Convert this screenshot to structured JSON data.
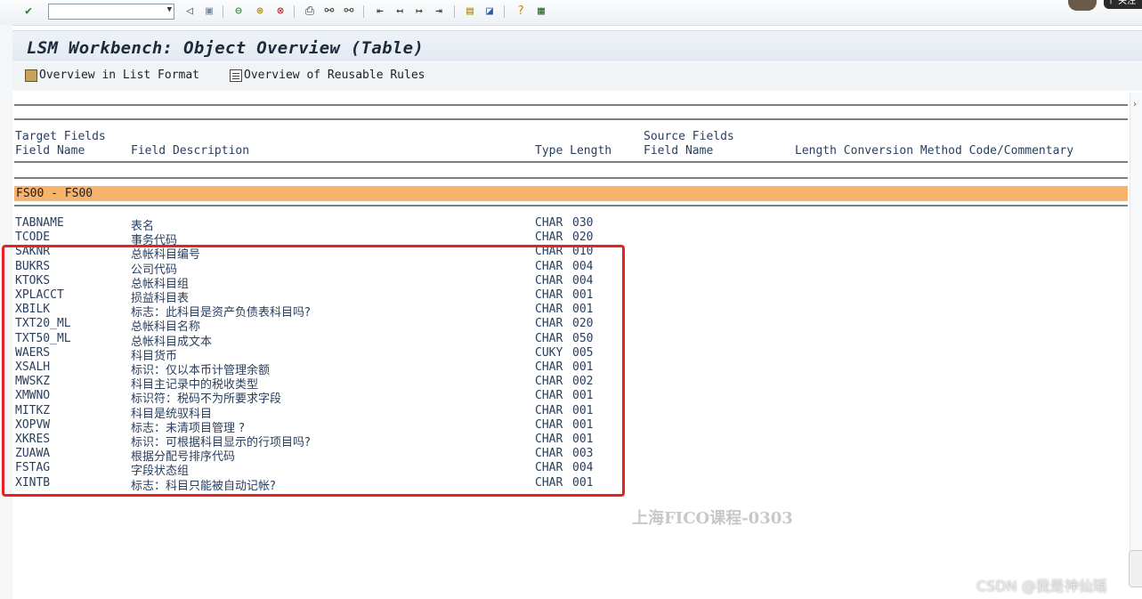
{
  "colors": {
    "group_bar": "#f7b26b",
    "highlight_box": "#e8231f",
    "text": "#2a3e5e"
  },
  "toolbar": {
    "icons": [
      "enter-icon",
      "command-dropdown-icon",
      "back-arrow-icon",
      "save-icon",
      "back-icon",
      "exit-icon",
      "cancel-icon",
      "print-icon",
      "find-icon",
      "find-next-icon",
      "first-page-icon",
      "previous-page-icon",
      "next-page-icon",
      "last-page-icon",
      "new-session-icon",
      "shortcut-icon",
      "help-icon",
      "layout-icon"
    ],
    "command_value": "",
    "avatar_text": "个 关注"
  },
  "title": "LSM Workbench: Object Overview (Table)",
  "app_toolbar": {
    "overview_list": "Overview in List Format",
    "overview_rules": "Overview of Reusable Rules"
  },
  "headers": {
    "target_fields": "Target Fields",
    "field_name": "Field Name",
    "field_description": "Field Description",
    "type_length": "Type Length",
    "source_fields": "Source Fields",
    "source_field_name": "Field Name",
    "conversion": "Length Conversion Method Code/Commentary"
  },
  "group": "FS00 - FS00",
  "rows": [
    {
      "name": "TABNAME",
      "desc": "表名",
      "type": "CHAR",
      "len": "030"
    },
    {
      "name": "TCODE",
      "desc": "事务代码",
      "type": "CHAR",
      "len": "020"
    },
    {
      "name": "SAKNR",
      "desc": "总帐科目编号",
      "type": "CHAR",
      "len": "010"
    },
    {
      "name": "BUKRS",
      "desc": "公司代码",
      "type": "CHAR",
      "len": "004"
    },
    {
      "name": "KTOKS",
      "desc": "总帐科目组",
      "type": "CHAR",
      "len": "004"
    },
    {
      "name": "XPLACCT",
      "desc": "损益科目表",
      "type": "CHAR",
      "len": "001"
    },
    {
      "name": "XBILK",
      "desc": "标志：此科目是资产负债表科目吗?",
      "type": "CHAR",
      "len": "001"
    },
    {
      "name": "TXT20_ML",
      "desc": "总帐科目名称",
      "type": "CHAR",
      "len": "020"
    },
    {
      "name": "TXT50_ML",
      "desc": "总帐科目成文本",
      "type": "CHAR",
      "len": "050"
    },
    {
      "name": "WAERS",
      "desc": "科目货币",
      "type": "CUKY",
      "len": "005"
    },
    {
      "name": "XSALH",
      "desc": "标识：仅以本币计管理余额",
      "type": "CHAR",
      "len": "001"
    },
    {
      "name": "MWSKZ",
      "desc": "科目主记录中的税收类型",
      "type": "CHAR",
      "len": "002"
    },
    {
      "name": "XMWNO",
      "desc": "标识符：税码不为所要求字段",
      "type": "CHAR",
      "len": "001"
    },
    {
      "name": "MITKZ",
      "desc": "科目是统驭科目",
      "type": "CHAR",
      "len": "001"
    },
    {
      "name": "XOPVW",
      "desc": "标志：未清项目管理 ?",
      "type": "CHAR",
      "len": "001"
    },
    {
      "name": "XKRES",
      "desc": "标识：可根据科目显示的行项目吗?",
      "type": "CHAR",
      "len": "001"
    },
    {
      "name": "ZUAWA",
      "desc": "根据分配号排序代码",
      "type": "CHAR",
      "len": "003"
    },
    {
      "name": "FSTAG",
      "desc": "字段状态组",
      "type": "CHAR",
      "len": "004"
    },
    {
      "name": "XINTB",
      "desc": "标志：科目只能被自动记帐?",
      "type": "CHAR",
      "len": "001"
    }
  ],
  "watermark": "上海FICO课程-0303",
  "csdn_credit": "CSDN @我是神仙瑶"
}
